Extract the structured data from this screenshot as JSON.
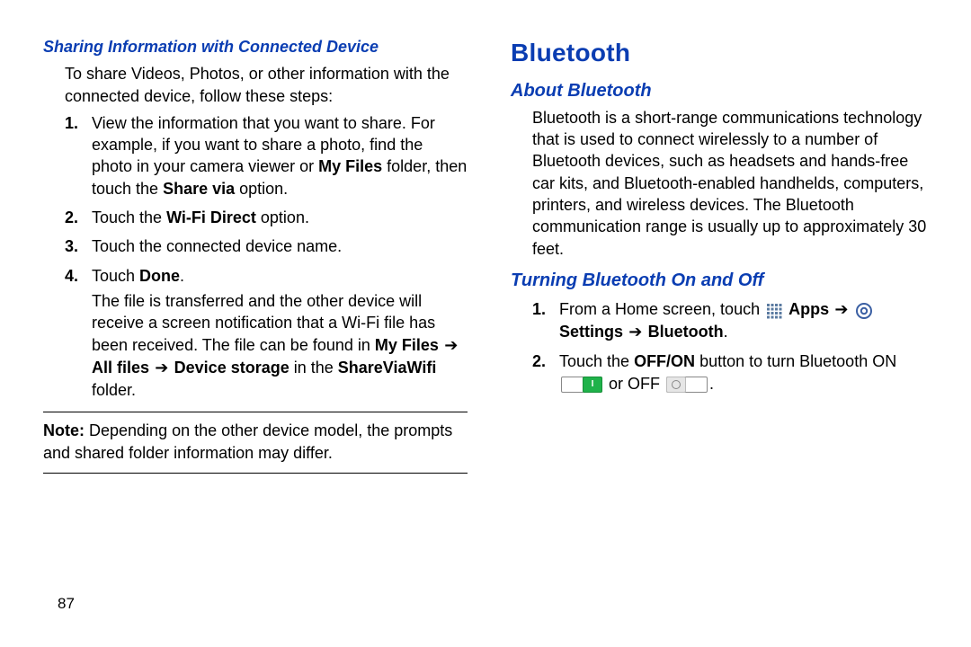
{
  "page_number": "87",
  "left": {
    "heading": "Sharing Information with Connected Device",
    "intro": "To share Videos, Photos, or other information with the connected device, follow these steps:",
    "steps": {
      "s1": {
        "num": "1.",
        "pre": "View the information that you want to share. For example, if you want to share a photo, find the photo in your camera viewer or ",
        "bold1": "My Files",
        "mid": " folder, then touch the ",
        "bold2": "Share via",
        "post": " option."
      },
      "s2": {
        "num": "2.",
        "pre": "Touch the ",
        "bold": "Wi-Fi Direct",
        "post": " option."
      },
      "s3": {
        "num": "3.",
        "text": "Touch the connected device name."
      },
      "s4": {
        "num": "4.",
        "pre": "Touch ",
        "bold": "Done",
        "post": ".",
        "para_pre": "The file is transferred and the other device will receive a screen notification that a Wi-Fi file has been received. The file can be found in ",
        "b1": "My Files",
        "arr1": " ➔ ",
        "b2": "All files",
        "arr2": " ➔ ",
        "b3": "Device storage",
        "mid2": " in the ",
        "b4": "ShareViaWifi",
        "para_post": " folder."
      }
    },
    "note_label": "Note:",
    "note_text": " Depending on the other device model, the prompts and shared folder information may differ."
  },
  "right": {
    "title": "Bluetooth",
    "about_heading": "About Bluetooth",
    "about_text": "Bluetooth is a short-range communications technology that is used to connect wirelessly to a number of Bluetooth devices, such as headsets and hands-free car kits, and Bluetooth-enabled handhelds, computers, printers, and wireless devices. The Bluetooth communication range is usually up to approximately 30 feet.",
    "turning_heading": "Turning Bluetooth On and Off",
    "steps": {
      "s1": {
        "num": "1.",
        "pre": "From a Home screen, touch ",
        "apps_label": "Apps",
        "arr1": " ➔ ",
        "settings_label": "Settings",
        "arr2": " ➔ ",
        "bt_label": "Bluetooth",
        "post": "."
      },
      "s2": {
        "num": "2.",
        "pre": "Touch the ",
        "offon": "OFF/ON",
        "mid": " button to turn Bluetooth ON ",
        "or": " or OFF ",
        "post": "."
      }
    }
  }
}
